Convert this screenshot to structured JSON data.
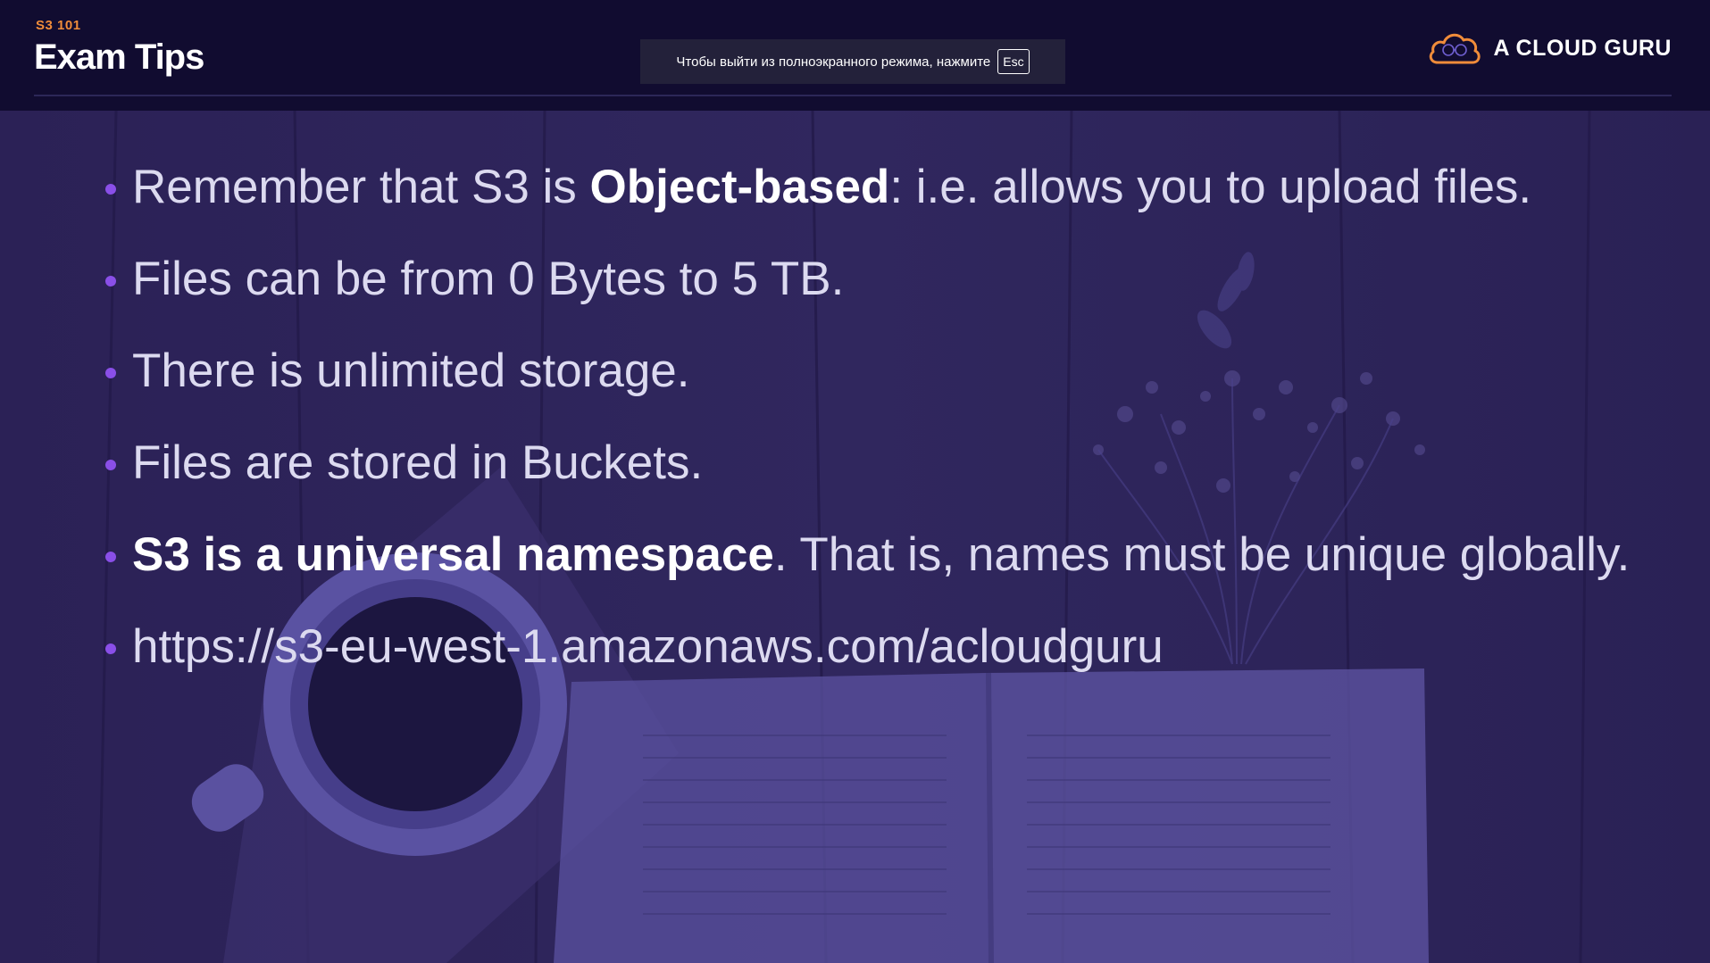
{
  "header": {
    "course_tag": "S3 101",
    "title": "Exam Tips",
    "fullscreen_notice": "Чтобы выйти из полноэкранного режима, нажмите",
    "esc_key": "Esc",
    "brand_name": "A CLOUD GURU",
    "brand_icon": "cloud-logo-icon"
  },
  "colors": {
    "header_bg": "#110c30",
    "slide_bg": "#2a2157",
    "accent_orange": "#f08c3a",
    "bullet_dot": "#8a4fe8",
    "text": "#dcdaf0"
  },
  "bullets": [
    {
      "pre": "Remember that S3 is ",
      "bold": "Object-based",
      "post": ": i.e. allows you to upload files."
    },
    {
      "pre": "Files can be from 0 Bytes to 5 TB.",
      "bold": "",
      "post": ""
    },
    {
      "pre": "There is unlimited storage.",
      "bold": "",
      "post": ""
    },
    {
      "pre": "Files are stored in Buckets.",
      "bold": "",
      "post": ""
    },
    {
      "pre": "",
      "bold": "S3 is a universal namespace",
      "post": ". That is, names must be unique globally."
    },
    {
      "pre": "https://s3-eu-west-1.amazonaws.com/acloudguru",
      "bold": "",
      "post": ""
    }
  ]
}
